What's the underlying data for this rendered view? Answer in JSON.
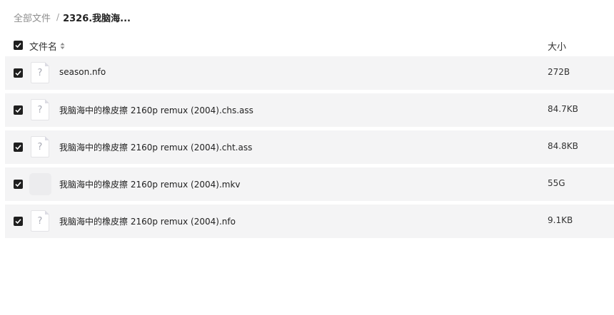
{
  "breadcrumb": {
    "root": "全部文件",
    "separator": "/",
    "current": "2326.我脑海..."
  },
  "table": {
    "header": {
      "name_label": "文件名",
      "size_label": "大小",
      "all_checked": true,
      "sort_icon": "sort-updown-icon"
    },
    "rows": [
      {
        "name": "season.nfo",
        "size": "272B",
        "checked": true,
        "icon": "unknown-file-icon"
      },
      {
        "name": "我脑海中的橡皮擦 2160p remux (2004).chs.ass",
        "size": "84.7KB",
        "checked": true,
        "icon": "unknown-file-icon"
      },
      {
        "name": "我脑海中的橡皮擦 2160p remux (2004).cht.ass",
        "size": "84.8KB",
        "checked": true,
        "icon": "unknown-file-icon"
      },
      {
        "name": "我脑海中的橡皮擦 2160p remux (2004).mkv",
        "size": "55G",
        "checked": true,
        "icon": "video-thumbnail-placeholder"
      },
      {
        "name": "我脑海中的橡皮擦 2160p remux (2004).nfo",
        "size": "9.1KB",
        "checked": true,
        "icon": "unknown-file-icon"
      }
    ]
  },
  "icons": {
    "unknown_glyph": "?"
  },
  "colors": {
    "row_background": "#f4f4f5",
    "checkbox": "#1f1f1f"
  }
}
